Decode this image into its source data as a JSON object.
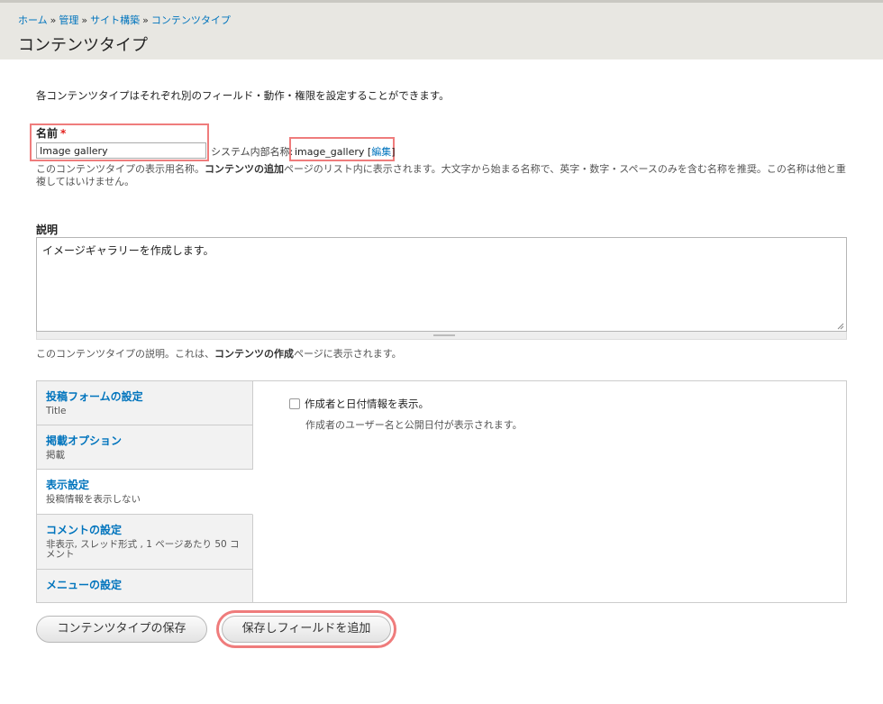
{
  "breadcrumb": {
    "items": [
      "ホーム",
      "管理",
      "サイト構築",
      "コンテンツタイプ"
    ],
    "separator": "»"
  },
  "page_title": "コンテンツタイプ",
  "intro": "各コンテンツタイプはそれぞれ別のフィールド・動作・権限を設定することができます。",
  "name_field": {
    "label": "名前",
    "required_mark": "*",
    "value": "Image gallery",
    "machine_label": "システム内部名称:",
    "machine_value": "image_gallery",
    "edit_link": "編集",
    "help_pre": "このコンテンツタイプの表示用名称。",
    "help_bold": "コンテンツの追加",
    "help_post": "ページのリスト内に表示されます。大文字から始まる名称で、英字・数字・スペースのみを含む名称を推奨。この名称は他と重複してはいけません。"
  },
  "description_field": {
    "label": "説明",
    "value": "イメージギャラリーを作成します。",
    "help_pre": "このコンテンツタイプの説明。これは、",
    "help_bold": "コンテンツの作成",
    "help_post": "ページに表示されます。"
  },
  "vertical_tabs": [
    {
      "title": "投稿フォームの設定",
      "summary": "Title"
    },
    {
      "title": "掲載オプション",
      "summary": "掲載"
    },
    {
      "title": "表示設定",
      "summary": "投稿情報を表示しない"
    },
    {
      "title": "コメントの設定",
      "summary": "非表示, スレッド形式 , 1 ページあたり 50 コメント"
    },
    {
      "title": "メニューの設定",
      "summary": ""
    }
  ],
  "display_pane": {
    "checkbox_label": "作成者と日付情報を表示。",
    "checkbox_checked": false,
    "checkbox_help": "作成者のユーザー名と公開日付が表示されます。"
  },
  "actions": {
    "save": "コンテンツタイプの保存",
    "save_add_fields": "保存しフィールドを追加"
  },
  "colors": {
    "link": "#0074bd",
    "highlight": "#ef7c7c",
    "header_bg": "#e8e7e2",
    "required": "#e3201c"
  }
}
